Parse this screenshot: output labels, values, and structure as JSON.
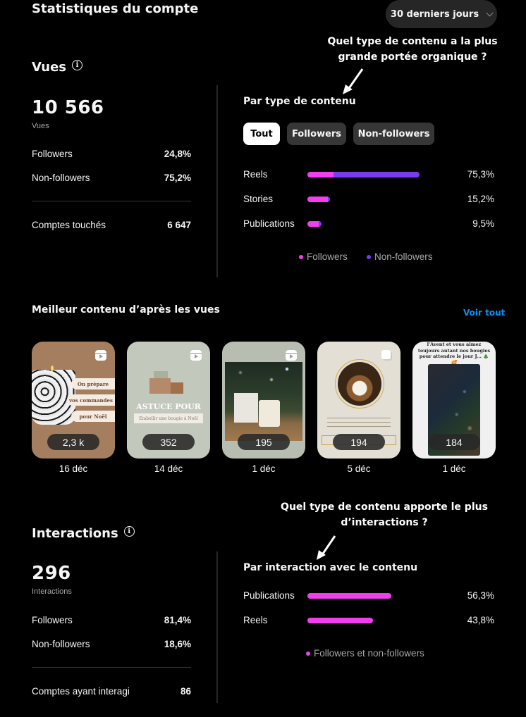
{
  "header": {
    "title": "Statistiques du compte",
    "period": "30 derniers jours"
  },
  "annotations": {
    "views_question": [
      "Quel type de contenu a la plus",
      "grande portée organique ?"
    ],
    "interactions_question": [
      "Quel type de contenu apporte le plus",
      "d’interactions ?"
    ]
  },
  "views": {
    "title": "Vues",
    "total": "10 566",
    "total_label": "Vues",
    "breakdown": [
      {
        "label": "Followers",
        "value": "24,8%"
      },
      {
        "label": "Non-followers",
        "value": "75,2%"
      }
    ],
    "accounts_label": "Comptes touchés",
    "accounts_value": "6 647",
    "by_type": {
      "title": "Par type de contenu",
      "filters": [
        {
          "label": "Tout",
          "active": true
        },
        {
          "label": "Followers",
          "active": false
        },
        {
          "label": "Non-followers",
          "active": false
        }
      ],
      "rows": [
        {
          "label": "Reels",
          "value": "75,3%",
          "total_pct": 75.3,
          "followers_share": 0.23
        },
        {
          "label": "Stories",
          "value": "15,2%",
          "total_pct": 15.2,
          "followers_share": 0.9
        },
        {
          "label": "Publications",
          "value": "9,5%",
          "total_pct": 9.5,
          "followers_share": 0.8
        }
      ],
      "legend": [
        {
          "label": "Followers",
          "color": "#f23ef0"
        },
        {
          "label": "Non-followers",
          "color": "#7a3bf0"
        }
      ]
    }
  },
  "top_content": {
    "title": "Meilleur contenu d’après les vues",
    "see_all": "Voir tout",
    "items": [
      {
        "views": "2,3 k",
        "date": "16 déc",
        "type": "reel",
        "texts": [
          "On prépare",
          "vos commandes",
          "pour Noël"
        ]
      },
      {
        "views": "352",
        "date": "14 déc",
        "type": "reel",
        "texts": [
          "ASTUCE POUR",
          "Embellir une bougie à Noël"
        ]
      },
      {
        "views": "195",
        "date": "1 déc",
        "type": "reel"
      },
      {
        "views": "194",
        "date": "5 déc",
        "type": "carousel"
      },
      {
        "views": "184",
        "date": "1 déc",
        "type": "story",
        "texts": [
          "l'Avent et vous aimez toujours autant nos bougies pour attendre le jour J... 🎄🥰"
        ]
      }
    ]
  },
  "interactions": {
    "title": "Interactions",
    "total": "296",
    "total_label": "Interactions",
    "breakdown": [
      {
        "label": "Followers",
        "value": "81,4%"
      },
      {
        "label": "Non-followers",
        "value": "18,6%"
      }
    ],
    "accounts_label": "Comptes ayant interagi",
    "accounts_value": "86",
    "by_interaction": {
      "title": "Par interaction avec le contenu",
      "rows": [
        {
          "label": "Publications",
          "value": "56,3%",
          "total_pct": 56.3
        },
        {
          "label": "Reels",
          "value": "43,8%",
          "total_pct": 43.8
        }
      ],
      "legend": [
        {
          "label": "Followers et non-followers",
          "color": "#f23ef0"
        }
      ]
    }
  },
  "colors": {
    "followers": "#f23ef0",
    "non_followers": "#7a3bf0",
    "link": "#0095f6"
  }
}
